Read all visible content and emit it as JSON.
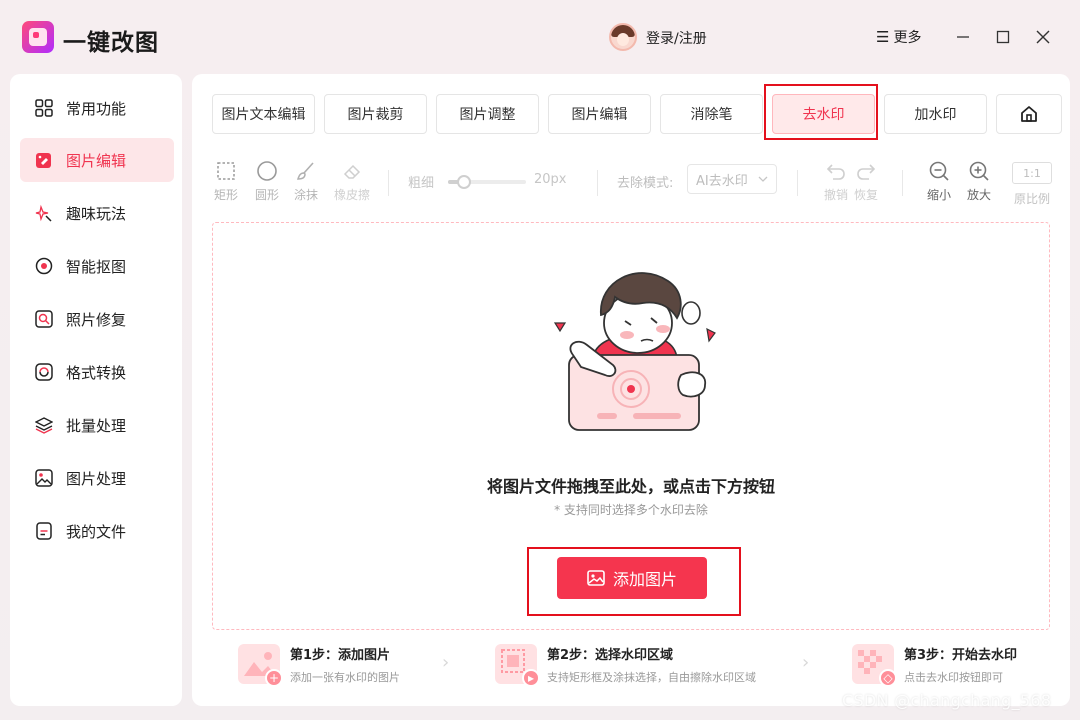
{
  "app": {
    "name": "一键改图",
    "login_label": "登录/注册",
    "more_label": "更多",
    "more_icon": "☰"
  },
  "sidebar": {
    "items": [
      {
        "label": "常用功能",
        "icon": "grid-icon"
      },
      {
        "label": "图片编辑",
        "icon": "edit-icon",
        "active": true
      },
      {
        "label": "趣味玩法",
        "icon": "sparkle-icon"
      },
      {
        "label": "智能抠图",
        "icon": "target-icon"
      },
      {
        "label": "照片修复",
        "icon": "repair-icon"
      },
      {
        "label": "格式转换",
        "icon": "convert-icon"
      },
      {
        "label": "批量处理",
        "icon": "layers-icon"
      },
      {
        "label": "图片处理",
        "icon": "image-icon"
      },
      {
        "label": "我的文件",
        "icon": "file-icon"
      }
    ]
  },
  "tabs": [
    {
      "label": "图片文本编辑"
    },
    {
      "label": "图片裁剪"
    },
    {
      "label": "图片调整"
    },
    {
      "label": "图片编辑"
    },
    {
      "label": "消除笔"
    },
    {
      "label": "去水印",
      "active": true
    },
    {
      "label": "加水印"
    }
  ],
  "toolbar": {
    "tools": [
      {
        "label": "矩形",
        "icon": "rect-select-icon"
      },
      {
        "label": "圆形",
        "icon": "circle-icon"
      },
      {
        "label": "涂抹",
        "icon": "brush-icon"
      },
      {
        "label": "橡皮擦",
        "icon": "eraser-icon"
      }
    ],
    "thickness_label": "粗细",
    "thickness_value": "20px",
    "thickness_fraction": 0.2,
    "mode_label": "去除模式:",
    "mode_value": "AI去水印",
    "undo_label": "撤销",
    "redo_label": "恢复",
    "zoom_out_label": "缩小",
    "zoom_in_label": "放大",
    "ratio_box": "1:1",
    "ratio_label": "原比例"
  },
  "dropzone": {
    "title": "将图片文件拖拽至此处，或点击下方按钮",
    "subtitle": "* 支持同时选择多个水印去除",
    "button_label": "添加图片"
  },
  "steps": [
    {
      "title": "第1步：添加图片",
      "desc": "添加一张有水印的图片"
    },
    {
      "title": "第2步：选择水印区域",
      "desc": "支持矩形框及涂抹选择，自由擦除水印区域"
    },
    {
      "title": "第3步：开始去水印",
      "desc": "点击去水印按钮即可"
    }
  ],
  "watermark": "CSDN @changchang_568",
  "colors": {
    "accent": "#f5354e",
    "active_bg": "#fde6e8",
    "highlight": "#e4101d"
  }
}
